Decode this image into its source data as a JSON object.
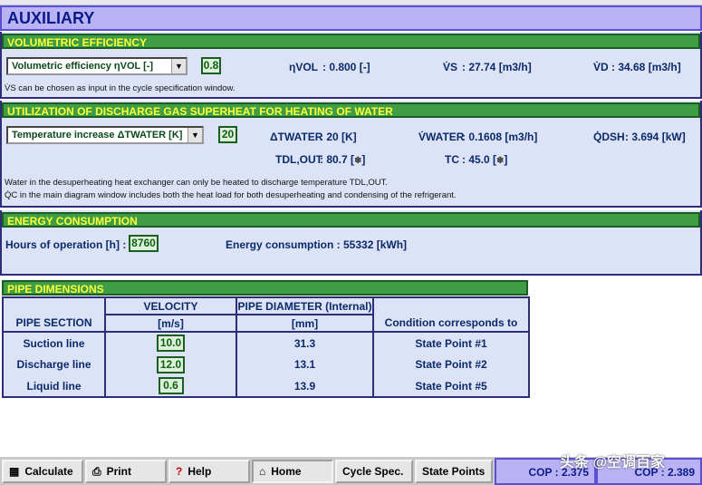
{
  "title": "AUXILIARY",
  "volumetric": {
    "header": "VOLUMETRIC EFFICIENCY",
    "combo_label": "Volumetric efficiency ηVOL [-]",
    "input_value": "0.8",
    "eta_label": "ηVOL",
    "eta_value": ": 0.800 [-]",
    "vs_label": "V̇S",
    "vs_value": ":  27.74 [m3/h]",
    "vd_label": "V̇D",
    "vd_value": ":  34.68 [m3/h]",
    "note": "V̇S can be chosen as input in the cycle specification window."
  },
  "superheat": {
    "header": "UTILIZATION OF DISCHARGE GAS SUPERHEAT FOR HEATING OF WATER",
    "combo_label": "Temperature increase ΔTWATER [K]",
    "input_value": "20",
    "dt_label": "ΔTWATER",
    "dt_value": ": 20 [K]",
    "vw_label": "V̇WATER",
    "vw_value": ":  0.1608 [m3/h]",
    "qdsh_label": "Q̇DSH",
    "qdsh_value": ":  3.694 [kW]",
    "tdl_label": "TDL,OUT",
    "tdl_value": ": 80.7 [",
    "tc_label": "TC",
    "tc_value": ":  45.0 [",
    "note1": "Water in the desuperheating heat exchanger can only be heated to discharge temperature TDL,OUT.",
    "note2": "Q̇C in the main diagram window includes both the heat load for both desuperheating and condensing of the refrigerant."
  },
  "energy": {
    "header": "ENERGY CONSUMPTION",
    "hours_label": "Hours of operation [h] :",
    "hours_value": "8760",
    "consumption_label": "Energy consumption :",
    "consumption_value": "55332 [kWh]"
  },
  "pipe": {
    "header": "PIPE DIMENSIONS",
    "col_section": "PIPE SECTION",
    "col_velocity": "VELOCITY",
    "col_velocity_unit": "[m/s]",
    "col_diameter": "PIPE DIAMETER (Internal)",
    "col_diameter_unit": "[mm]",
    "col_condition": "Condition corresponds to",
    "rows": [
      {
        "section": "Suction line",
        "velocity": "10.0",
        "diameter": "31.3",
        "condition": "State Point #1"
      },
      {
        "section": "Discharge line",
        "velocity": "12.0",
        "diameter": "13.1",
        "condition": "State Point #2"
      },
      {
        "section": "Liquid line",
        "velocity": "0.6",
        "diameter": "13.9",
        "condition": "State Point #5"
      }
    ]
  },
  "toolbar": {
    "calculate": "Calculate",
    "print": "Print",
    "help": "Help",
    "home": "Home",
    "cycle_spec": "Cycle Spec.",
    "state_points": "State Points",
    "cop1": "COP : 2.375",
    "cop2": "COP : 2.389"
  },
  "watermark": "头条 @空调百家",
  "colors": {
    "section_header_bg": "#3e9d45",
    "section_header_text": "#ffff3a",
    "panel_bg": "#dde3f7",
    "title_bg": "#b9b2f4"
  }
}
